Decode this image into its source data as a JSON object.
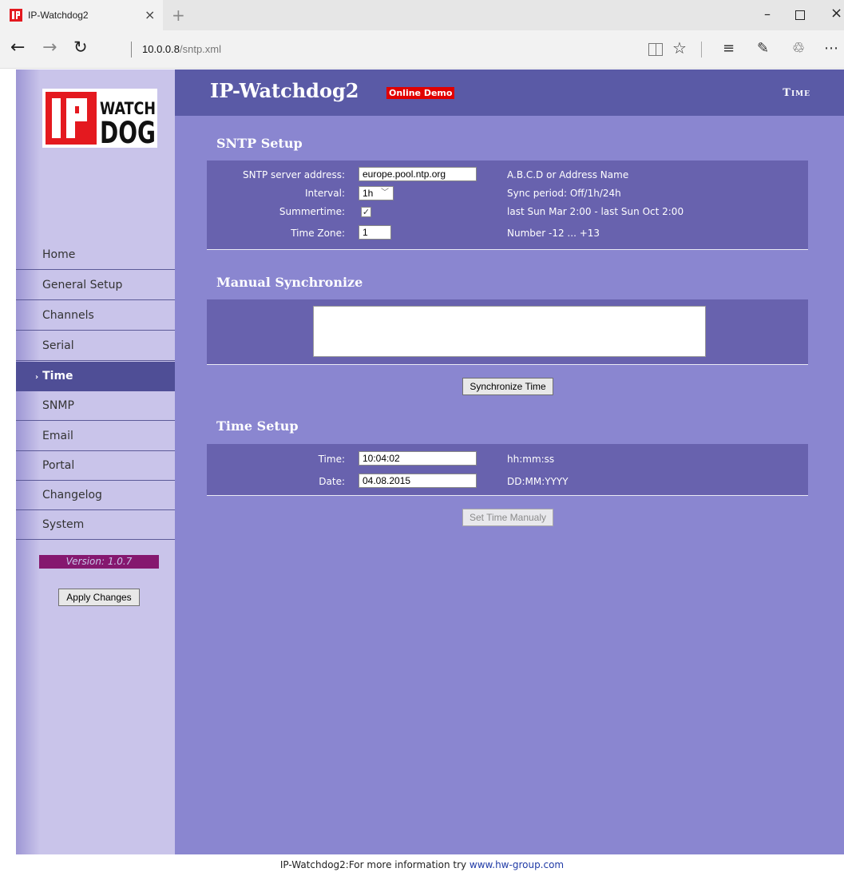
{
  "browser": {
    "tab_title": "IP-Watchdog2",
    "tab_close": "×",
    "new_tab": "+",
    "url_host": "10.0.0.8",
    "url_path": "/sntp.xml",
    "window_min": "–",
    "window_close": "×"
  },
  "icons": {
    "back": "←",
    "forward": "→",
    "refresh": "↻",
    "favorite": "☆",
    "hub": "≡",
    "note": "✎",
    "share": "♲",
    "more": "⋯",
    "check": "✓",
    "chevron": "﹀",
    "arrow": "›"
  },
  "header": {
    "title": "IP-Watchdog2",
    "badge": "Online Demo",
    "page": "Time"
  },
  "logo": {
    "letters_ip": "IP",
    "word_top": "WATCH",
    "word_bottom": "DOG",
    "colors": {
      "red": "#e4191f",
      "dark": "#111111"
    }
  },
  "sidebar": {
    "items": [
      {
        "label": "Home",
        "active": false
      },
      {
        "label": "General Setup",
        "active": false
      },
      {
        "label": "Channels",
        "active": false
      },
      {
        "label": "Serial",
        "active": false
      },
      {
        "label": "Time",
        "active": true
      },
      {
        "label": "SNMP",
        "active": false
      },
      {
        "label": "Email",
        "active": false
      },
      {
        "label": "Portal",
        "active": false
      },
      {
        "label": "Changelog",
        "active": false
      },
      {
        "label": "System",
        "active": false
      }
    ],
    "version": "Version: 1.0.7",
    "apply_label": "Apply Changes"
  },
  "sntp": {
    "title": "SNTP Setup",
    "server_label": "SNTP server address:",
    "server_value": "europe.pool.ntp.org",
    "server_hint": "A.B.C.D or Address Name",
    "interval_label": "Interval:",
    "interval_value": "1h",
    "interval_hint": "Sync period: Off/1h/24h",
    "summertime_label": "Summertime:",
    "summertime_checked": true,
    "summertime_hint": "last Sun Mar 2:00 - last Sun Oct 2:00",
    "tz_label": "Time Zone:",
    "tz_value": "1",
    "tz_hint": "Number -12 ... +13"
  },
  "manual": {
    "title": "Manual Synchronize",
    "output": "",
    "button": "Synchronize Time"
  },
  "time_setup": {
    "title": "Time Setup",
    "time_label": "Time:",
    "time_value": "10:04:02",
    "time_hint": "hh:mm:ss",
    "date_label": "Date:",
    "date_value": "04.08.2015",
    "date_hint": "DD:MM:YYYY",
    "button": "Set Time Manualy"
  },
  "footer": {
    "text": "IP-Watchdog2:For more information try ",
    "link": "www.hw-group.com"
  },
  "colors": {
    "header": "#5a5aa6",
    "main": "#8a86d0",
    "panel": "#6862ae",
    "nav_active": "#4f4e96",
    "badge": "#e10000",
    "version_bg": "#85186f"
  }
}
